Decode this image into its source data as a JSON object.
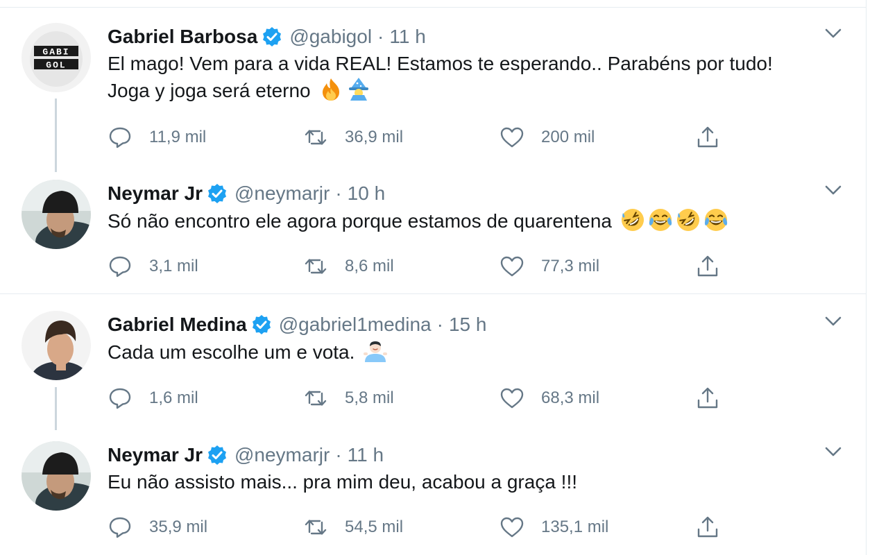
{
  "tweets": [
    {
      "name": "Gabriel Barbosa",
      "handle": "@gabigol",
      "dot": "·",
      "time": "11 h",
      "text_line1": "El mago! Vem para a vida REAL! Estamos te esperando.. Parabéns por tudo!",
      "text_line2": "Joga y joga será eterno",
      "emojis": [
        "fire-emoji",
        "mage-emoji"
      ],
      "avatar_label": "GABI GOL",
      "replies": "11,9 mil",
      "retweets": "36,9 mil",
      "likes": "200 mil"
    },
    {
      "name": "Neymar Jr",
      "handle": "@neymarjr",
      "dot": "·",
      "time": "10 h",
      "text_line1": "Só não encontro ele agora porque estamos de quarentena",
      "emojis": [
        "rolling-laugh-emoji",
        "tears-of-joy-emoji",
        "rolling-laugh-emoji",
        "tears-of-joy-emoji"
      ],
      "replies": "3,1 mil",
      "retweets": "8,6 mil",
      "likes": "77,3 mil"
    },
    {
      "name": "Gabriel Medina",
      "handle": "@gabriel1medina",
      "dot": "·",
      "time": "15 h",
      "text_line1": "Cada um escolhe um e vota.",
      "emojis": [
        "man-shrugging-emoji"
      ],
      "replies": "1,6 mil",
      "retweets": "5,8 mil",
      "likes": "68,3 mil"
    },
    {
      "name": "Neymar Jr",
      "handle": "@neymarjr",
      "dot": "·",
      "time": "11 h",
      "text_line1": "Eu não assisto mais... pra mim deu, acabou a graça !!!",
      "replies": "35,9 mil",
      "retweets": "54,5 mil",
      "likes": "135,1 mil"
    }
  ],
  "colors": {
    "verified_blue": "#1da1f2",
    "text_primary": "#14171a",
    "text_secondary": "#657786",
    "thread_line": "#ccd6dd",
    "divider": "#e6ecf0"
  },
  "icons": [
    "reply-icon",
    "retweet-icon",
    "like-icon",
    "share-icon",
    "verified-badge-icon",
    "chevron-down-icon"
  ]
}
